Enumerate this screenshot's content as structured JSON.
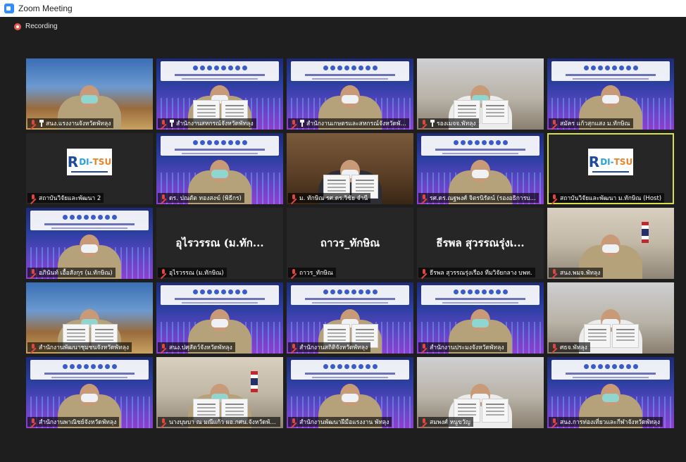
{
  "window": {
    "title": "Zoom Meeting",
    "app_icon": "zoom-icon"
  },
  "status": {
    "recording_label": "Recording",
    "recording_icon": "recording-icon"
  },
  "colors": {
    "host_border": "#d7e04a",
    "muted_icon": "#e2463e",
    "recording_dot": "#e85a4f"
  },
  "participants": [
    {
      "name": "สนง.แรงงานจังหวัดพัทลุง",
      "muted": true,
      "pinned": true,
      "video": "scenic"
    },
    {
      "name": "สำนักงานสหกรณ์จังหวัดพัทลุง",
      "muted": true,
      "pinned": true,
      "video": "banner"
    },
    {
      "name": "สำนักงานเกษตรและสหกรณ์จังหวัดพั...",
      "muted": true,
      "pinned": true,
      "video": "banner"
    },
    {
      "name": "รองเมจจ.พัทลุง",
      "muted": true,
      "pinned": true,
      "video": "office"
    },
    {
      "name": "สมัคร แก้วสุกแสง ม.ทักษิณ",
      "muted": true,
      "pinned": false,
      "video": "banner"
    },
    {
      "name": "สถาบันวิจัยและพัฒนา 2",
      "muted": true,
      "pinned": false,
      "video": "logo"
    },
    {
      "name": "ดร. ปณตัต ทองสงฆ์ (พิธีกร)",
      "muted": true,
      "pinned": false,
      "video": "banner"
    },
    {
      "name": "ม. ทักษิณ รศ.ดร.วิชัย จำนี",
      "muted": true,
      "pinned": false,
      "video": "warm"
    },
    {
      "name": "รศ.ดร.ณฐพงศ์ จิตรนิรัตน์ (รองอธิการบ...",
      "muted": true,
      "pinned": false,
      "video": "banner"
    },
    {
      "name": "สถาบันวิจัยและพัฒนา ม.ทักษิณ (Host)",
      "muted": true,
      "pinned": false,
      "video": "logo",
      "host": true
    },
    {
      "name": "อภินันท์ เอื้อสังกุร (ม.ทักษิณ)",
      "muted": true,
      "pinned": false,
      "video": "banner"
    },
    {
      "name": "อุไรวรรณ (ม.ทักษิณ)",
      "muted": true,
      "pinned": false,
      "video": "off",
      "display_name": "อุไรวรรณ (ม.ทัก..."
    },
    {
      "name": "ถาวร_ทักษิณ",
      "muted": true,
      "pinned": false,
      "video": "off",
      "display_name": "ถาวร_ทักษิณ"
    },
    {
      "name": "ธีรพล สุวรรณรุ่งเรือง ทีมวิจัยกลาง บพท.",
      "muted": true,
      "pinned": false,
      "video": "off",
      "display_name": "ธีรพล สุวรรณรุ่งเ..."
    },
    {
      "name": "สนง.พมจ.พัทลุง",
      "muted": true,
      "pinned": false,
      "video": "room"
    },
    {
      "name": "สำนักงานพัฒนาชุมชนจังหวัดพัทลุง",
      "muted": true,
      "pinned": false,
      "video": "scenic"
    },
    {
      "name": "สนง.ปศุสัตว์จังหวัดพัทลุง",
      "muted": true,
      "pinned": false,
      "video": "banner"
    },
    {
      "name": "สำนักงานสถิติจังหวัดพัทลุง",
      "muted": true,
      "pinned": false,
      "video": "banner"
    },
    {
      "name": "สำนักงานประมงจังหวัดพัทลุง",
      "muted": true,
      "pinned": false,
      "video": "banner"
    },
    {
      "name": "ศธจ.พัทลุง",
      "muted": true,
      "pinned": false,
      "video": "office"
    },
    {
      "name": "สำนักงานพาณิชย์จังหวัดพัทลุง",
      "muted": true,
      "pinned": false,
      "video": "banner"
    },
    {
      "name": "นางบุษบา ณ มณีแก้ว ผอ.กศน.จังหวัดพัทลุง",
      "muted": true,
      "pinned": false,
      "video": "room"
    },
    {
      "name": "สำนักงานพัฒนาฝีมือแรงงาน พัทลุง",
      "muted": true,
      "pinned": false,
      "video": "banner"
    },
    {
      "name": "สมพงศ์ หนูขวัญ",
      "muted": true,
      "pinned": false,
      "video": "office"
    },
    {
      "name": "สนง.การท่องเที่ยวและกีฬาจังหวัดพัทลุง",
      "muted": true,
      "pinned": false,
      "video": "banner"
    }
  ]
}
